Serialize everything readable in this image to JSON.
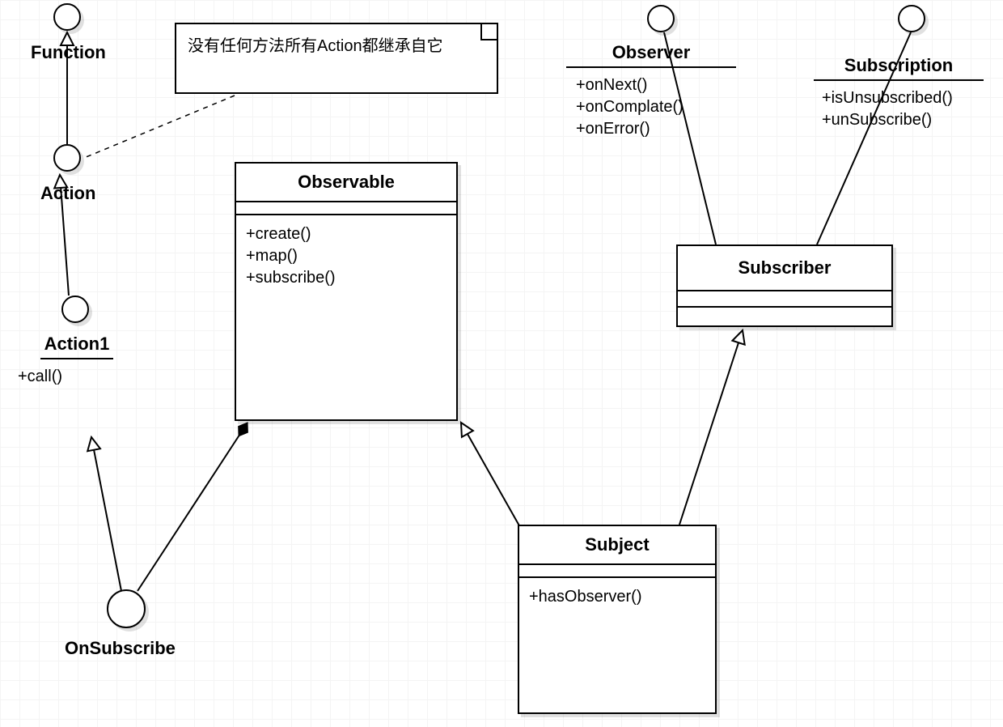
{
  "note": {
    "text": "没有任何方法所有Action都继承自它"
  },
  "interfaces": {
    "function": {
      "name": "Function"
    },
    "action": {
      "name": "Action"
    },
    "action1": {
      "name": "Action1",
      "m0": "+call()"
    },
    "onSubscribe": {
      "name": "OnSubscribe"
    },
    "observer": {
      "name": "Observer",
      "m0": "+onNext()",
      "m1": "+onComplate()",
      "m2": "+onError()"
    },
    "subscription": {
      "name": "Subscription",
      "m0": "+isUnsubscribed()",
      "m1": "+unSubscribe()"
    }
  },
  "classes": {
    "observable": {
      "name": "Observable",
      "m0": "+create()",
      "m1": "+map()",
      "m2": "+subscribe()"
    },
    "subscriber": {
      "name": "Subscriber"
    },
    "subject": {
      "name": "Subject",
      "m0": "+hasObserver()"
    }
  }
}
